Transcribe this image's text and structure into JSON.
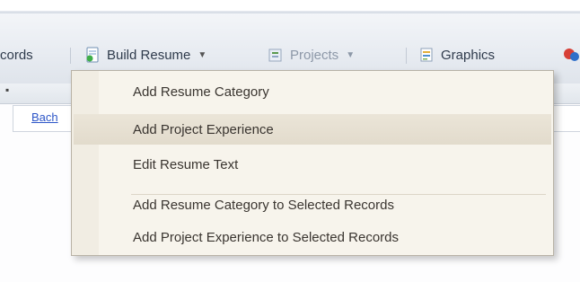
{
  "toolbar": {
    "records_label": "cords",
    "build_resume_label": "Build Resume",
    "projects_label": "Projects",
    "graphics_label": "Graphics"
  },
  "grid": {
    "link_text": "Bach"
  },
  "menu": {
    "items": [
      {
        "label": "Add Resume Category"
      },
      {
        "label": "Add Project Experience",
        "highlighted": true
      },
      {
        "label": "Edit Resume Text"
      },
      {
        "label": "Add Resume Category to Selected Records"
      },
      {
        "label": "Add Project Experience to Selected Records"
      }
    ]
  },
  "icons": {
    "build_resume": "resume-document-icon",
    "projects": "projects-icon",
    "graphics": "graphics-icon",
    "overflow": "toolbar-overflow-icon"
  },
  "colors": {
    "menu_background": "#f7f4ec",
    "menu_highlight": "#e6dfd1",
    "toolbar_background": "#e7ebf1",
    "link_color": "#2d56c8"
  }
}
